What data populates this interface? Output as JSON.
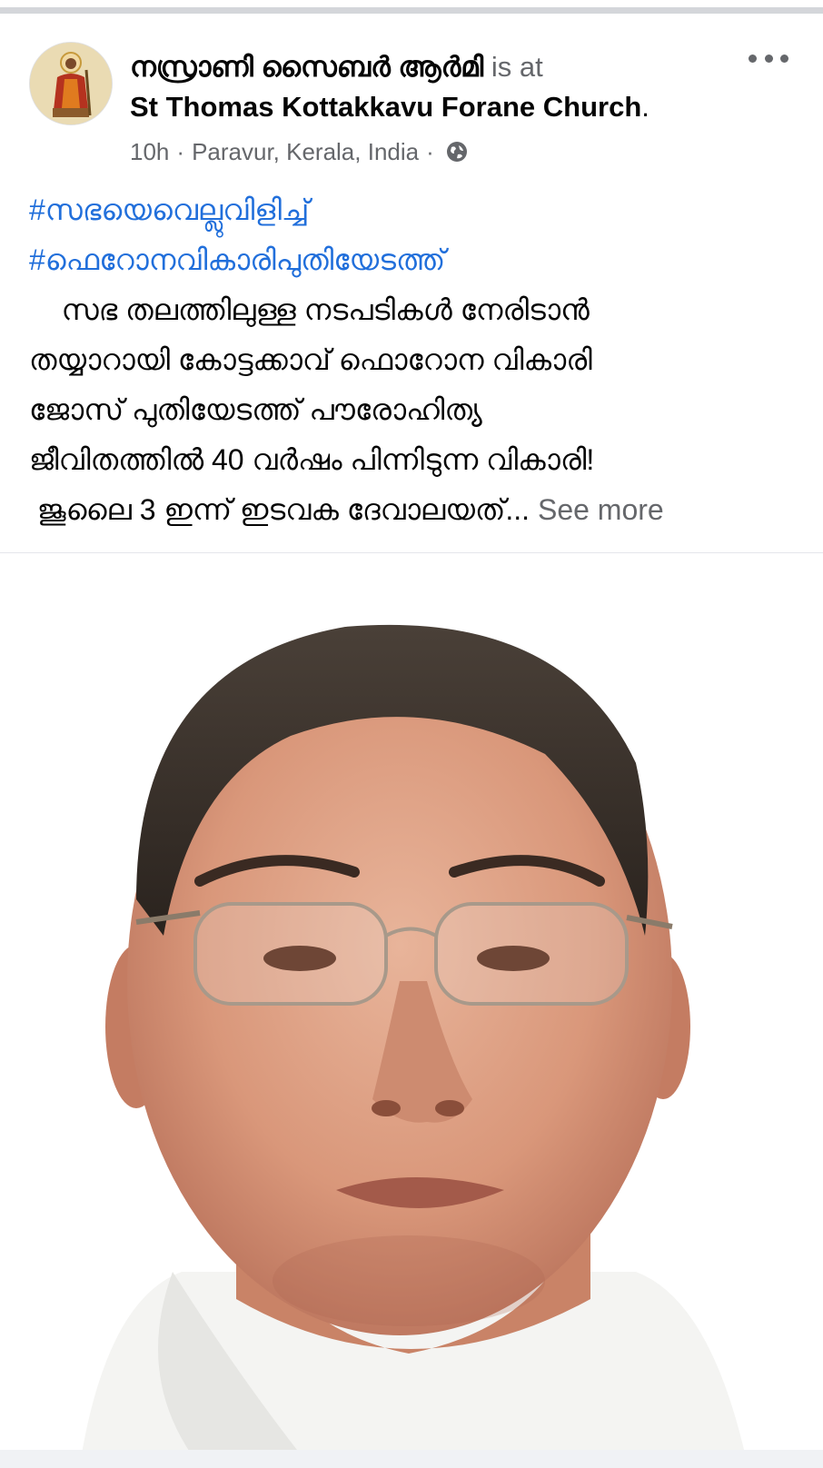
{
  "post": {
    "author": "നസ്രാണി സൈബർ ആർമി",
    "is_at": "is at",
    "place": "St Thomas Kottakkavu Forane Church",
    "place_suffix": ".",
    "time": "10h",
    "separator": "·",
    "location": "Paravur, Kerala, India",
    "privacy_icon": "globe-icon",
    "menu_icon": "more-options-icon",
    "hashtags": [
      "#സഭയെവെല്ലുവിളിച്ച്",
      "#ഫെറോനവികാരിപുതിയേടത്ത്"
    ],
    "body_lines": [
      "    സഭ തലത്തിലുള്ള നടപടികൾ നേരിടാൻ",
      "തയ്യാറായി കോട്ടക്കാവ് ഫൊറോന വികാരി",
      "ജോസ് പുതിയേടത്ത് പൗരോഹിത്യ",
      "ജീവിതത്തിൽ 40 വർഷം പിന്നിടുന്ന വികാരി!",
      " ജൂലൈ 3 ഇന്ന് ഇടവക ദേവാലയത്..."
    ],
    "see_more": "See more"
  },
  "colors": {
    "link_blue": "#216fdb",
    "secondary_gray": "#65676b",
    "text_dark": "#050505",
    "divider": "#d4d6da"
  }
}
